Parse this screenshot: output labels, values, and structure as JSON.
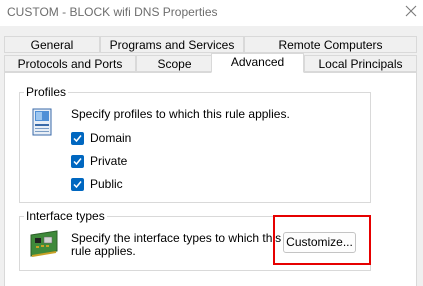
{
  "window": {
    "title": "CUSTOM - BLOCK wifi DNS Properties"
  },
  "tabs": {
    "row1": [
      "General",
      "Programs and Services",
      "Remote Computers"
    ],
    "row2": [
      "Protocols and Ports",
      "Scope",
      "Advanced",
      "Local Principals"
    ],
    "active": "Advanced"
  },
  "profiles": {
    "title": "Profiles",
    "description": "Specify profiles to which this rule applies.",
    "options": [
      {
        "label": "Domain",
        "checked": true
      },
      {
        "label": "Private",
        "checked": true
      },
      {
        "label": "Public",
        "checked": true
      }
    ]
  },
  "interface_types": {
    "title": "Interface types",
    "description_line1": "Specify the interface types to which this",
    "description_line2": "rule applies.",
    "customize_label": "Customize..."
  },
  "colors": {
    "checkbox": "#0067c0",
    "highlight": "#e60000"
  }
}
